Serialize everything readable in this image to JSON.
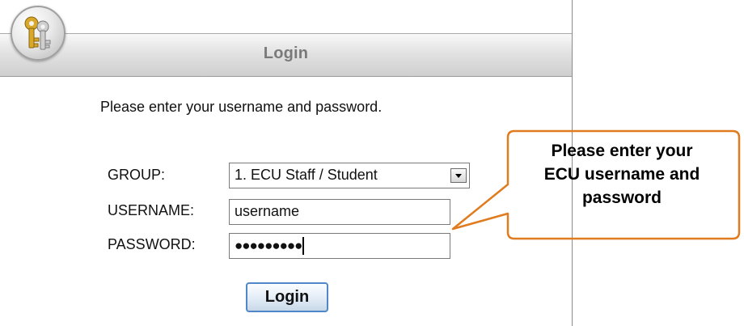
{
  "window": {
    "title": "Login"
  },
  "form": {
    "prompt": "Please enter your username and password.",
    "group": {
      "label": "GROUP:",
      "selected": "1. ECU Staff / Student"
    },
    "username": {
      "label": "USERNAME:",
      "value": "username"
    },
    "password": {
      "label": "PASSWORD:",
      "masked_value": "●●●●●●●●●"
    },
    "login_button": "Login"
  },
  "callout": {
    "lines": [
      "Please enter your",
      "ECU username and",
      "password"
    ],
    "border_color": "#e07b1f"
  },
  "colors": {
    "button_border": "#4f87c8",
    "title_text": "#7a7a7a"
  },
  "icons": {
    "logo": "keys-icon",
    "select_arrow": "chevron-down-icon"
  }
}
